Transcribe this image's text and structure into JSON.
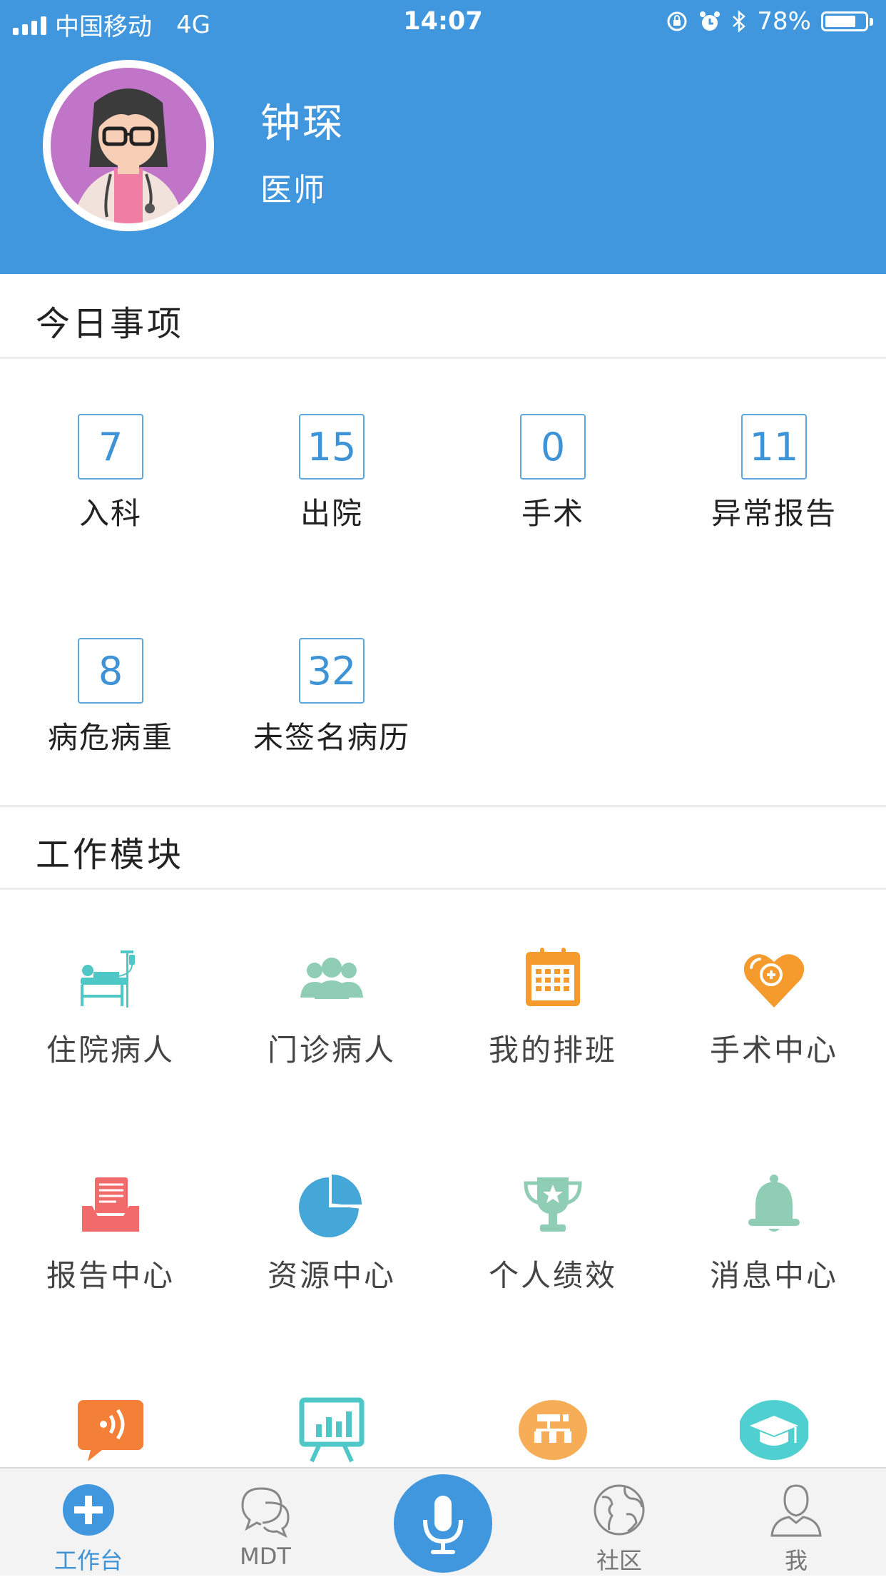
{
  "status_bar": {
    "carrier": "中国移动",
    "network": "4G",
    "time": "14:07",
    "battery": "78%",
    "battery_level": 0.78
  },
  "profile": {
    "name": "钟琛",
    "role": "医师"
  },
  "today": {
    "title": "今日事项",
    "items": [
      {
        "count": "7",
        "label": "入科"
      },
      {
        "count": "15",
        "label": "出院"
      },
      {
        "count": "0",
        "label": "手术"
      },
      {
        "count": "11",
        "label": "异常报告"
      },
      {
        "count": "8",
        "label": "病危病重"
      },
      {
        "count": "32",
        "label": "未签名病历"
      }
    ]
  },
  "modules": {
    "title": "工作模块",
    "items": [
      {
        "label": "住院病人",
        "icon": "inpatient-bed-icon",
        "color": "#4fc7c6"
      },
      {
        "label": "门诊病人",
        "icon": "outpatient-group-icon",
        "color": "#8fcdb4"
      },
      {
        "label": "我的排班",
        "icon": "calendar-icon",
        "color": "#f59b2d"
      },
      {
        "label": "手术中心",
        "icon": "heart-plus-icon",
        "color": "#f59b2d"
      },
      {
        "label": "报告中心",
        "icon": "report-tray-icon",
        "color": "#f26b6b"
      },
      {
        "label": "资源中心",
        "icon": "pie-chart-icon",
        "color": "#45a6d8"
      },
      {
        "label": "个人绩效",
        "icon": "trophy-icon",
        "color": "#8fcdb4"
      },
      {
        "label": "消息中心",
        "icon": "bell-icon",
        "color": "#8fcdb4"
      },
      {
        "icon": "speech-bubble-icon",
        "color": "#f47f36"
      },
      {
        "icon": "presentation-chart-icon",
        "color": "#4fc7c6"
      },
      {
        "icon": "org-chart-icon",
        "color": "#f7ad58"
      },
      {
        "icon": "graduation-cap-icon",
        "color": "#4fcfcf"
      }
    ]
  },
  "tabbar": {
    "tabs": [
      {
        "label": "工作台",
        "icon": "plus-circle-icon",
        "active": true
      },
      {
        "label": "MDT",
        "icon": "chat-bubbles-icon"
      },
      {
        "icon": "microphone-icon"
      },
      {
        "label": "社区",
        "icon": "globe-icon"
      },
      {
        "label": "我",
        "icon": "person-icon"
      }
    ]
  },
  "colors": {
    "header": "#4097de",
    "accent": "#3d93d6"
  }
}
